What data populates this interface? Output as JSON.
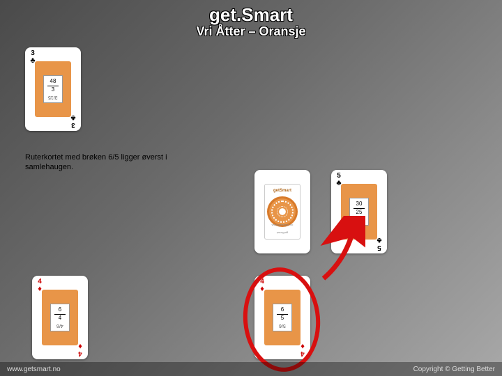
{
  "header": {
    "title": "get.Smart",
    "subtitle": "Vri Åtter – Oransje"
  },
  "caption": "Ruterkortet med brøken 6/5 ligger øverst i samlehaugen.",
  "cards": {
    "topLeft": {
      "rank": "3",
      "suit": "♣",
      "color": "black",
      "num": "48",
      "den": "3",
      "rot": "3/15"
    },
    "middleBack": {
      "brand": "getSmart",
      "url": "www.getsmart.no"
    },
    "middleRight": {
      "rank": "5",
      "suit": "♣",
      "color": "black",
      "num": "30",
      "den": "25",
      "rot": "5/16"
    },
    "bottomLeft": {
      "rank": "4",
      "suit": "♦",
      "color": "red",
      "num": "6",
      "den": "4",
      "rot": "4/6"
    },
    "bottomCenter": {
      "rank": "4",
      "suit": "♦",
      "color": "red",
      "num": "6",
      "den": "5",
      "rot": "5/6"
    }
  },
  "footer": {
    "left": "www.getsmart.no",
    "right": "Copyright © Getting Better"
  }
}
